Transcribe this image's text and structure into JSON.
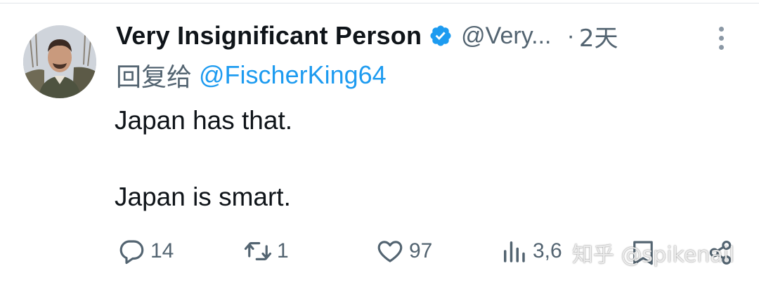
{
  "author": {
    "display_name": "Very Insignificant Person",
    "handle": "@Very...",
    "time_separator": "·",
    "time": "2天",
    "avatar": "avatar-photo"
  },
  "reply": {
    "prefix": "回复给",
    "mention": "@FischerKing64"
  },
  "tweet": {
    "line1": "Japan has that.",
    "line2": "Japan is smart."
  },
  "actions": {
    "reply": {
      "icon": "reply-icon",
      "count": "14"
    },
    "retweet": {
      "icon": "retweet-icon",
      "count": "1"
    },
    "like": {
      "icon": "heart-icon",
      "count": "97"
    },
    "views": {
      "icon": "views-icon",
      "count": "3,6"
    },
    "bookmark": {
      "icon": "bookmark-icon"
    },
    "share": {
      "icon": "share-icon"
    }
  },
  "watermark": "知乎 @spikenail",
  "colors": {
    "text": "#0f1419",
    "secondary": "#536471",
    "link": "#1d9bf0",
    "verified": "#1d9bf0"
  }
}
